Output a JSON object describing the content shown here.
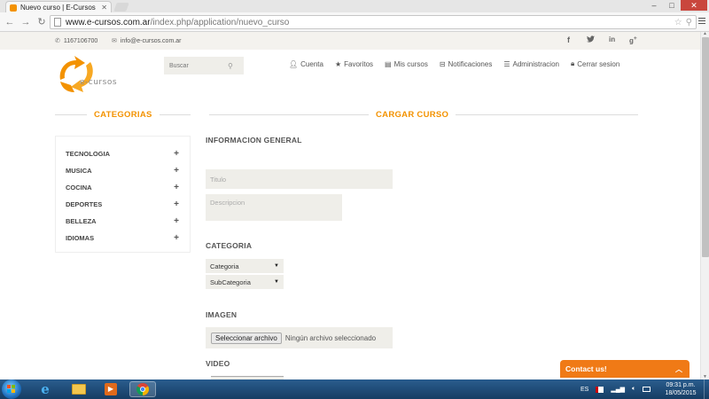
{
  "browser": {
    "tab_title": "Nuevo curso | E-Cursos",
    "url_host": "www.e-cursos.com.ar",
    "url_path": "/index.php/application/nuevo_curso"
  },
  "topbar": {
    "phone": "1167106700",
    "email": "info@e-cursos.com.ar"
  },
  "header": {
    "brand": "e-cursos",
    "search_placeholder": "Buscar",
    "nav": {
      "cuenta": "Cuenta",
      "favoritos": "Favoritos",
      "mis_cursos": "Mis cursos",
      "notificaciones": "Notificaciones",
      "administracion": "Administracion",
      "cerrar_sesion": "Cerrar sesion"
    }
  },
  "sidebar": {
    "title": "CATEGORIAS",
    "items": [
      {
        "label": "TECNOLOGIA"
      },
      {
        "label": "MUSICA"
      },
      {
        "label": "COCINA"
      },
      {
        "label": "DEPORTES"
      },
      {
        "label": "BELLEZA"
      },
      {
        "label": "IDIOMAS"
      }
    ]
  },
  "form": {
    "title": "CARGAR CURSO",
    "general_heading": "INFORMACION GENERAL",
    "titulo_placeholder": "Titulo",
    "descripcion_placeholder": "Descripcion",
    "categoria_heading": "CATEGORIA",
    "categoria_value": "Categoria",
    "subcategoria_value": "SubCategoria",
    "imagen_heading": "IMAGEN",
    "file_button": "Seleccionar archivo",
    "file_status": "Ningún archivo seleccionado",
    "video_heading": "VIDEO"
  },
  "contact_widget": {
    "label": "Contact us!"
  },
  "taskbar": {
    "language": "ES",
    "time": "09:31 p.m.",
    "date": "18/05/2015"
  },
  "colors": {
    "accent": "#f39200",
    "contact_widget": "#f07a16",
    "field_bg": "#efeee9",
    "topbar_bg": "#f4f2ee"
  }
}
